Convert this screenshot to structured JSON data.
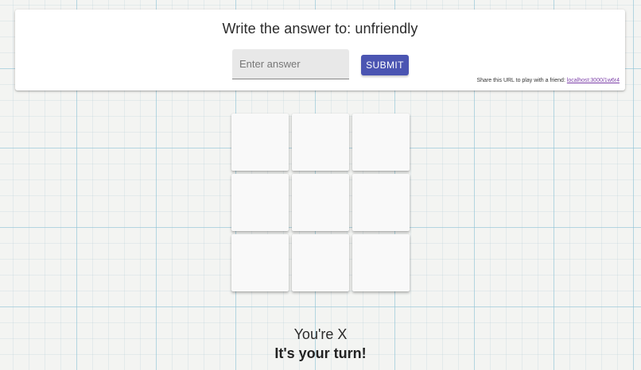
{
  "header": {
    "prompt": "Write the answer to: unfriendly",
    "answer_input": {
      "value": "",
      "placeholder": "Enter answer"
    },
    "submit_label": "SUBMIT",
    "share_text": "Share this URL to play with a friend: ",
    "share_link": "localhost:3000/1w6r4"
  },
  "board": {
    "cells": [
      "",
      "",
      "",
      "",
      "",
      "",
      "",
      "",
      ""
    ]
  },
  "status": {
    "player": "You're X",
    "turn": "It's your turn!"
  },
  "colors": {
    "submit_button": "#4b55b2",
    "share_link": "#7c3fa8",
    "grid_lines": "#8cc3d7"
  }
}
